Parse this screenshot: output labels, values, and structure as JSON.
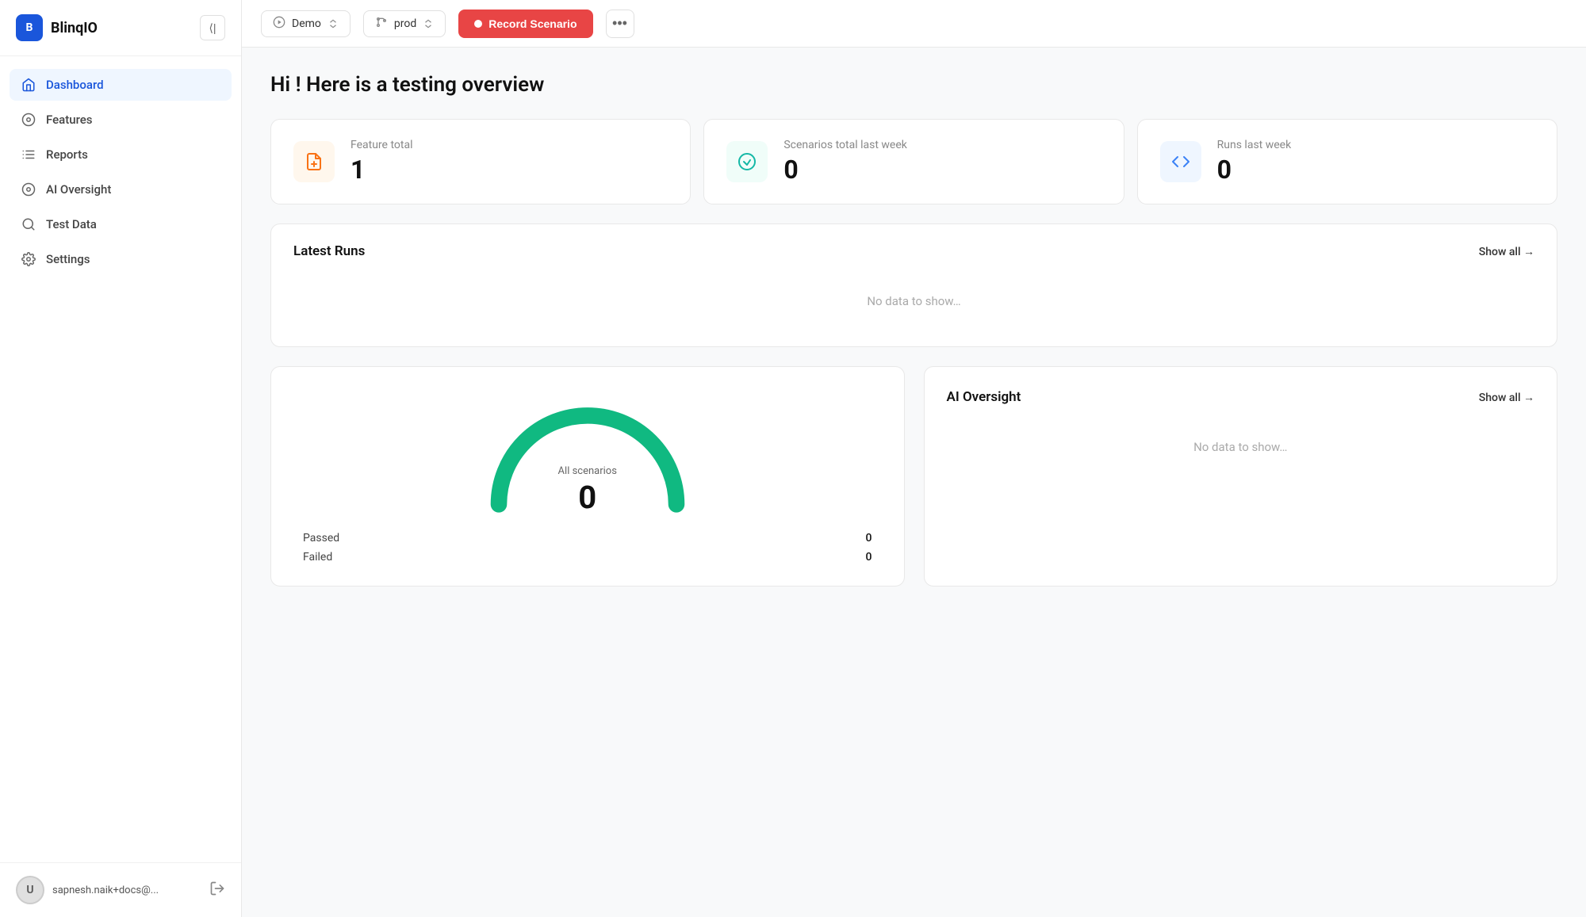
{
  "app": {
    "name": "BlinqIO",
    "logo_letter": "B"
  },
  "topbar": {
    "demo_label": "Demo",
    "prod_label": "prod",
    "record_label": "Record Scenario",
    "more_icon": "•••"
  },
  "sidebar": {
    "collapse_icon": "⟨",
    "items": [
      {
        "id": "dashboard",
        "label": "Dashboard",
        "active": true,
        "icon": "house"
      },
      {
        "id": "features",
        "label": "Features",
        "active": false,
        "icon": "target"
      },
      {
        "id": "reports",
        "label": "Reports",
        "active": false,
        "icon": "list"
      },
      {
        "id": "ai-oversight",
        "label": "AI Oversight",
        "active": false,
        "icon": "circle-dot"
      },
      {
        "id": "test-data",
        "label": "Test Data",
        "active": false,
        "icon": "search"
      },
      {
        "id": "settings",
        "label": "Settings",
        "active": false,
        "icon": "gear"
      }
    ],
    "user_email": "sapnesh.naik+docs@...",
    "user_initial": "U",
    "logout_icon": "→"
  },
  "dashboard": {
    "greeting": "Hi ! Here is a testing overview",
    "stats": [
      {
        "id": "feature-total",
        "label": "Feature total",
        "value": "1",
        "icon_type": "orange",
        "icon": "📄"
      },
      {
        "id": "scenarios-total",
        "label": "Scenarios total last week",
        "value": "0",
        "icon_type": "teal",
        "icon": "⟳"
      },
      {
        "id": "runs-last-week",
        "label": "Runs last week",
        "value": "0",
        "icon_type": "blue",
        "icon": "⌨"
      }
    ],
    "latest_runs": {
      "title": "Latest Runs",
      "show_all": "Show all →",
      "empty": "No data to show…"
    },
    "scenarios_chart": {
      "title": "All scenarios",
      "value": "0",
      "passed_label": "Passed",
      "passed_value": "0",
      "failed_label": "Failed",
      "failed_value": "0"
    },
    "ai_oversight": {
      "title": "AI Oversight",
      "show_all": "Show all →",
      "empty": "No data to show…"
    }
  }
}
